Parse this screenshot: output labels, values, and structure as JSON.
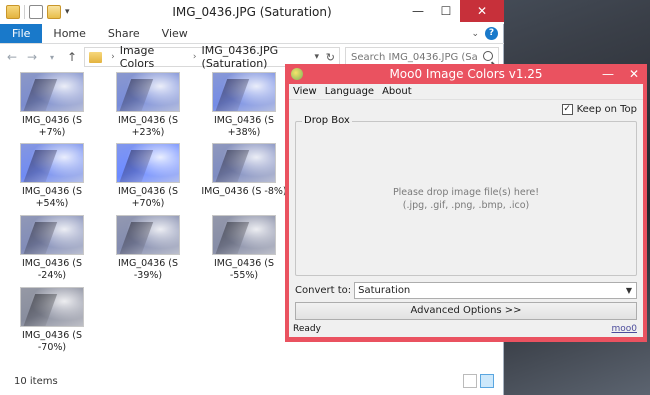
{
  "explorer": {
    "title": "IMG_0436.JPG (Saturation)",
    "ribbon_tabs": [
      "File",
      "Home",
      "Share",
      "View"
    ],
    "breadcrumb": [
      "Image Colors",
      "IMG_0436.JPG (Saturation)"
    ],
    "search_placeholder": "Search IMG_0436.JPG (Saturati...",
    "files": [
      {
        "line1": "IMG_0436 (S",
        "line2": "+7%)",
        "sat": 1.15
      },
      {
        "line1": "IMG_0436 (S",
        "line2": "+23%)",
        "sat": 1.35
      },
      {
        "line1": "IMG_0436 (S",
        "line2": "+38%)",
        "sat": 1.55
      },
      {
        "line1": "IMG_0436 (S",
        "line2": "+54%)",
        "sat": 1.8
      },
      {
        "line1": "IMG_0436 (S",
        "line2": "+70%)",
        "sat": 2.1
      },
      {
        "line1": "IMG_0436 (S -8%)",
        "line2": "",
        "sat": 0.92
      },
      {
        "line1": "IMG_0436 (S",
        "line2": "-24%)",
        "sat": 0.76
      },
      {
        "line1": "IMG_0436 (S",
        "line2": "-39%)",
        "sat": 0.61
      },
      {
        "line1": "IMG_0436 (S",
        "line2": "-55%)",
        "sat": 0.45
      },
      {
        "line1": "IMG_0436 (S",
        "line2": "-70%)",
        "sat": 0.3
      }
    ],
    "status": "10 items"
  },
  "moo": {
    "title": "Moo0 Image Colors v1.25",
    "menu": [
      "View",
      "Language",
      "About"
    ],
    "keep_on_top_label": "Keep on Top",
    "keep_on_top_checked": true,
    "drop_box_label": "Drop Box",
    "drop_hint_line1": "Please drop image file(s) here!",
    "drop_hint_line2": "(.jpg, .gif, .png, .bmp, .ico)",
    "convert_label": "Convert to:",
    "convert_value": "Saturation",
    "advanced_label": "Advanced Options >>",
    "status": "Ready",
    "link": "moo0"
  },
  "colors": {
    "file_tab": "#1979ca",
    "moo_frame": "#ea5260",
    "thumb_base": "#7d8cc6"
  }
}
